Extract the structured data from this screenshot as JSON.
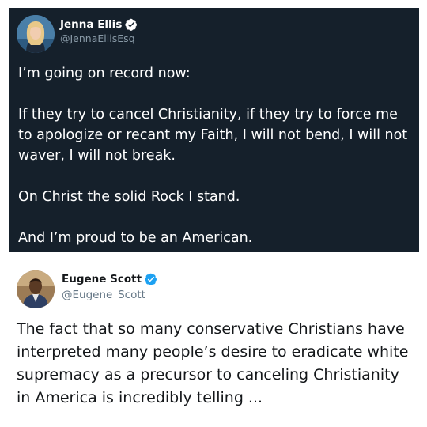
{
  "tweets": [
    {
      "theme": "dark",
      "display_name": "Jenna Ellis",
      "handle": "@JennaEllisEsq",
      "verified": true,
      "avatar_icon": "profile-photo-avatar",
      "text": "I’m going on record now:\n\nIf they try to cancel Christianity, if they try to force me to apologize or recant my Faith, I will not bend, I will not waver, I will not break.\n\nOn Christ the solid Rock I stand.\n\nAnd I’m proud to be an American."
    },
    {
      "theme": "light",
      "display_name": "Eugene Scott",
      "handle": "@Eugene_Scott",
      "verified": true,
      "avatar_icon": "profile-photo-avatar",
      "text": "The fact that so many conservative Christians have interpreted many people’s desire to eradicate white supremacy as a precursor to canceling Christianity in America is incredibly telling ..."
    }
  ],
  "colors": {
    "dark_bg": "#15202b",
    "dark_secondary": "#8899a6",
    "light_text": "#14171a",
    "light_secondary": "#657786",
    "verified_blue": "#1da1f2"
  }
}
